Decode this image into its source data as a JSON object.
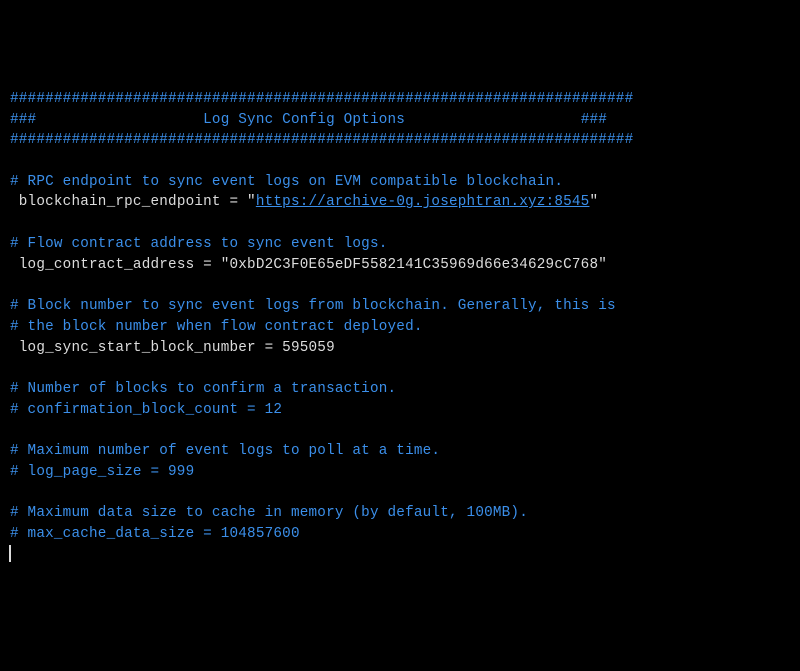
{
  "header": {
    "bar1": "#######################################################################",
    "bar2_left": "###",
    "bar2_title": "Log Sync Config Options",
    "bar2_right": "###",
    "bar3": "#######################################################################"
  },
  "s1_comment": "# RPC endpoint to sync event logs on EVM compatible blockchain.",
  "s1_key": "blockchain_rpc_endpoint",
  "s1_eq": " = \"",
  "s1_val": "https://archive-0g.josephtran.xyz:8545",
  "s1_end": "\"",
  "s2_comment": "# Flow contract address to sync event logs.",
  "s2_line": "log_contract_address = \"0xbD2C3F0E65eDF5582141C35969d66e34629cC768\"",
  "s3_c1": "# Block number to sync event logs from blockchain. Generally, this is",
  "s3_c2": "# the block number when flow contract deployed.",
  "s3_line": "log_sync_start_block_number = 595059",
  "s4_c": "# Number of blocks to confirm a transaction.",
  "s4_line": "# confirmation_block_count = 12",
  "s5_c": "# Maximum number of event logs to poll at a time.",
  "s5_line": "# log_page_size = 999",
  "s6_c": "# Maximum data size to cache in memory (by default, 100MB).",
  "s6_line": "# max_cache_data_size = 104857600"
}
